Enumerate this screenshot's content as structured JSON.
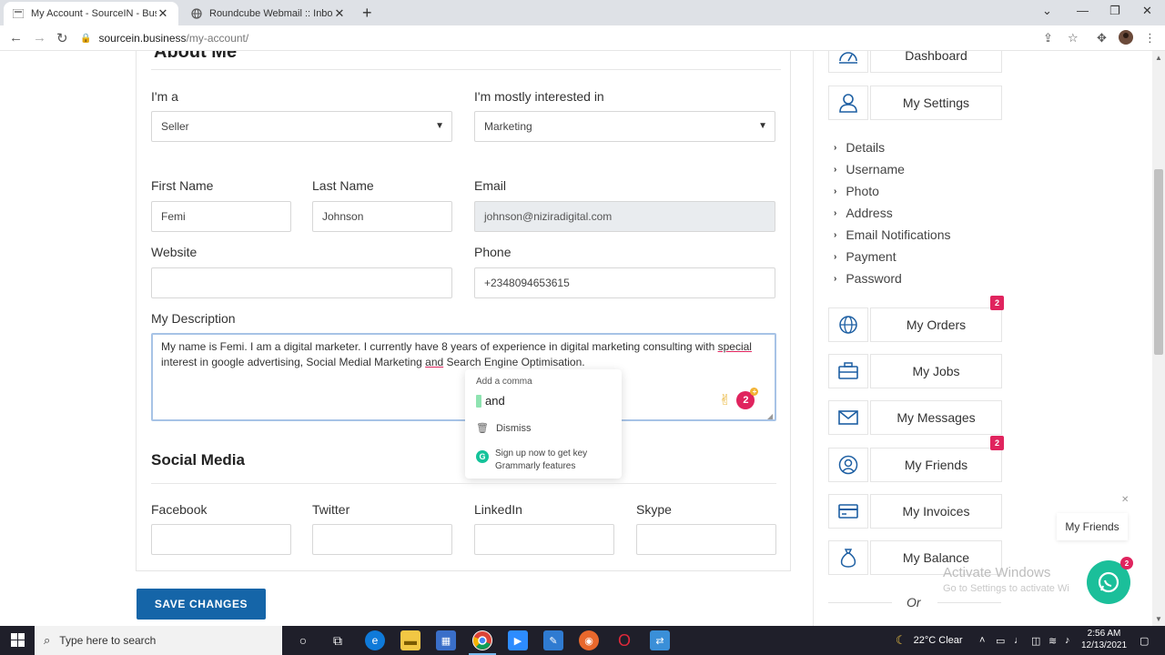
{
  "browser": {
    "tabs": [
      {
        "title": "My Account - SourceIN - Busine",
        "active": true
      },
      {
        "title": "Roundcube Webmail :: Inbox",
        "active": false
      }
    ],
    "url_host": "sourcein.business",
    "url_path": "/my-account/"
  },
  "form": {
    "section_heading": "About Me",
    "im_a_label": "I'm a",
    "im_a_value": "Seller",
    "interest_label": "I'm mostly interested in",
    "interest_value": "Marketing",
    "first_name_label": "First Name",
    "first_name_value": "Femi",
    "last_name_label": "Last Name",
    "last_name_value": "Johnson",
    "email_label": "Email",
    "email_value": "johnson@niziradigital.com",
    "website_label": "Website",
    "website_value": "",
    "phone_label": "Phone",
    "phone_value": "+2348094653615",
    "description_label": "My Description",
    "description_part1": "My name is Femi. I am a digital marketer. I currently have 8 years of experience in digital marketing consulting with ",
    "description_part2": "special",
    "description_part3": " interest in google advertising, Social Medial Marketing ",
    "description_part4": "and",
    "description_part5": " Search Engine Optimisation.",
    "grammarly_count": "2",
    "social_title": "Social Media",
    "facebook_label": "Facebook",
    "twitter_label": "Twitter",
    "linkedin_label": "LinkedIn",
    "skype_label": "Skype",
    "save_label": "SAVE CHANGES"
  },
  "grammarly_popup": {
    "title": "Add a comma",
    "suggestion": "and",
    "dismiss": "Dismiss",
    "signup": "Sign up now to get key",
    "signup2": "Grammarly features"
  },
  "sidebar": {
    "dashboard": "Dashboard",
    "settings": "My Settings",
    "sub_items": [
      "Details",
      "Username",
      "Photo",
      "Address",
      "Email Notifications",
      "Payment",
      "Password"
    ],
    "orders": "My Orders",
    "orders_badge": "2",
    "jobs": "My Jobs",
    "messages": "My Messages",
    "friends": "My Friends",
    "friends_badge": "2",
    "invoices": "My Invoices",
    "balance": "My Balance",
    "or": "Or"
  },
  "overlay": {
    "activate_title": "Activate Windows",
    "activate_sub": "Go to Settings to activate Wi",
    "chat_tip": "My Friends",
    "chat_badge": "2"
  },
  "taskbar": {
    "search_placeholder": "Type here to search",
    "weather": "22°C  Clear",
    "time": "2:56 AM",
    "date": "12/13/2021"
  },
  "colors": {
    "primary_button": "#1565a8",
    "badge": "#e0245e",
    "chat": "#1bbf9a"
  }
}
